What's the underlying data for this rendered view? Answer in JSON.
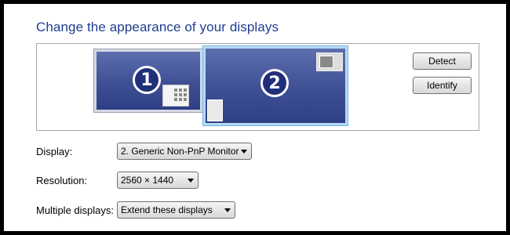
{
  "header": {
    "title": "Change the appearance of your displays"
  },
  "monitors": [
    {
      "number": "1"
    },
    {
      "number": "2"
    }
  ],
  "buttons": {
    "detect": "Detect",
    "identify": "Identify"
  },
  "settings": {
    "display": {
      "label": "Display:",
      "value": "2. Generic Non-PnP Monitor"
    },
    "resolution": {
      "label": "Resolution:",
      "value": "2560 × 1440"
    },
    "multiple": {
      "label": "Multiple displays:",
      "value": "Extend these displays"
    }
  }
}
